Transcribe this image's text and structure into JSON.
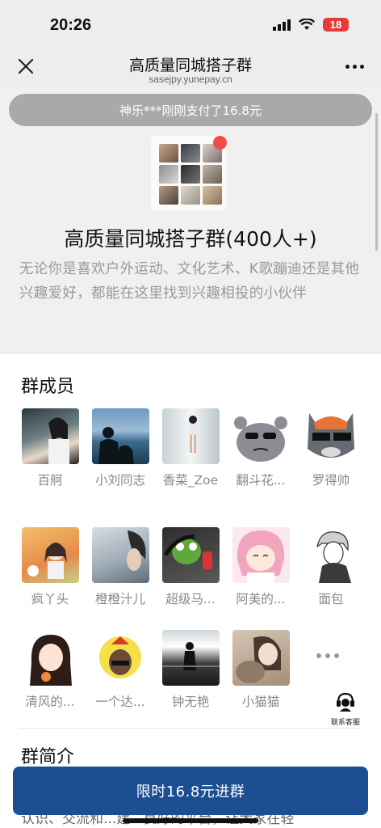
{
  "status_bar": {
    "time": "20:26",
    "battery": "18"
  },
  "nav": {
    "title": "高质量同城搭子群",
    "url": "sasejpy.yunepay.cn"
  },
  "notice": "神乐***刚刚支付了16.8元",
  "group": {
    "title": "高质量同城搭子群(400人+)",
    "description": "无论你是喜欢户外运动、文化艺术、K歌蹦迪还是其他兴趣爱好，都能在这里找到兴趣相投的小伙伴"
  },
  "members_section": {
    "title": "群成员",
    "members": [
      {
        "name": "百舸"
      },
      {
        "name": "小刘同志"
      },
      {
        "name": "香菜_Zoe"
      },
      {
        "name": "翻斗花..."
      },
      {
        "name": "罗得帅"
      },
      {
        "name": "疯丫头"
      },
      {
        "name": "橙橙汁儿"
      },
      {
        "name": "超级马..."
      },
      {
        "name": "阿美的..."
      },
      {
        "name": "面包"
      },
      {
        "name": "清风的..."
      },
      {
        "name": "一个达..."
      },
      {
        "name": "钟无艳"
      },
      {
        "name": "小猫猫"
      }
    ]
  },
  "customer_service": {
    "label": "联系客服"
  },
  "intro": {
    "title": "群简介",
    "text": "认识、交流和...建...良好的平台，让大家在轻"
  },
  "cta": {
    "label": "限时16.8元进群"
  },
  "colors": {
    "cta": "#1b4f91",
    "notice_bg": "#a9a9a9",
    "badge_red": "#f44a4a"
  }
}
